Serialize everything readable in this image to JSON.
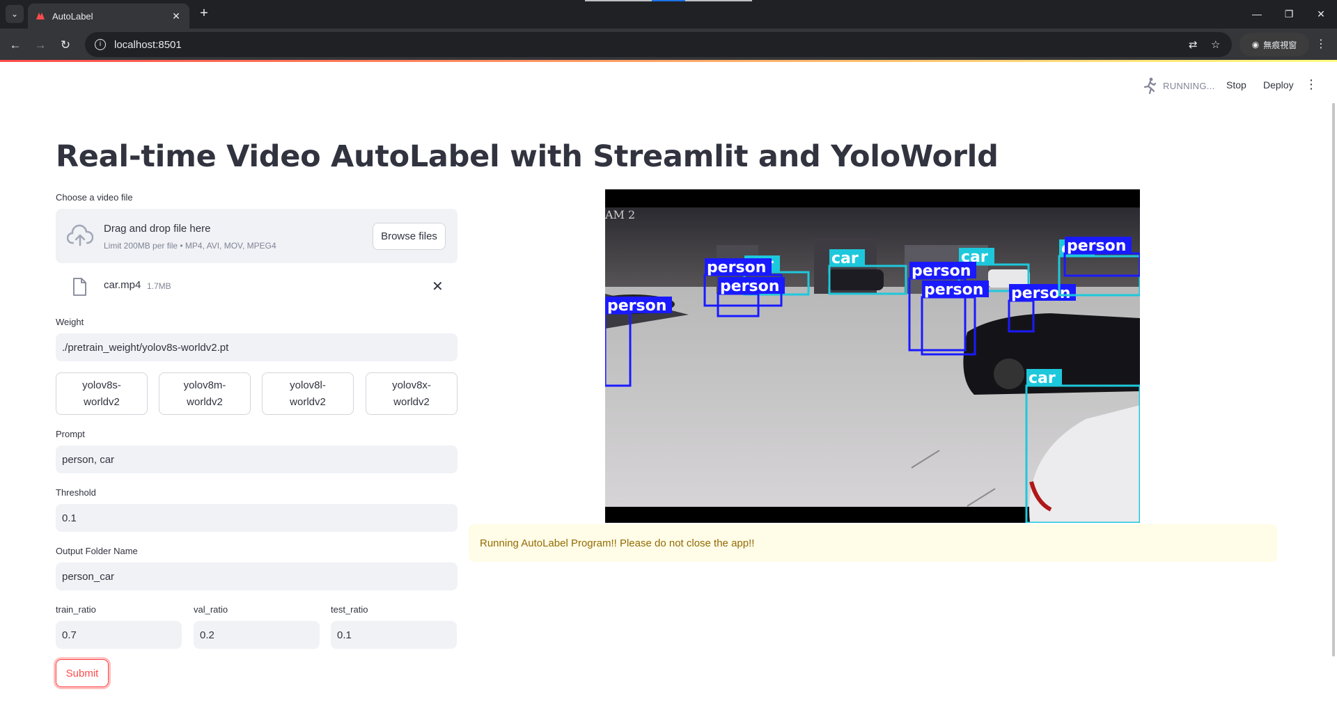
{
  "browser": {
    "tab_title": "AutoLabel",
    "url": "localhost:8501",
    "profile_label": "無痕視窗"
  },
  "header": {
    "status": "RUNNING...",
    "stop_label": "Stop",
    "deploy_label": "Deploy"
  },
  "page": {
    "title": "Real-time Video AutoLabel with Streamlit and YoloWorld"
  },
  "uploader": {
    "label": "Choose a video file",
    "drag_text": "Drag and drop file here",
    "limit_text": "Limit 200MB per file • MP4, AVI, MOV, MPEG4",
    "browse_label": "Browse files",
    "file_name": "car.mp4",
    "file_size": "1.7MB"
  },
  "weight": {
    "label": "Weight",
    "value": "./pretrain_weight/yolov8s-worldv2.pt",
    "models": [
      {
        "line1": "yolov8s-",
        "line2": "worldv2"
      },
      {
        "line1": "yolov8m-",
        "line2": "worldv2"
      },
      {
        "line1": "yolov8l-",
        "line2": "worldv2"
      },
      {
        "line1": "yolov8x-",
        "line2": "worldv2"
      }
    ]
  },
  "prompt": {
    "label": "Prompt",
    "value": "person, car"
  },
  "threshold": {
    "label": "Threshold",
    "value": "0.1"
  },
  "output": {
    "label": "Output Folder Name",
    "value": "person_car"
  },
  "ratios": {
    "train": {
      "label": "train_ratio",
      "value": "0.7"
    },
    "val": {
      "label": "val_ratio",
      "value": "0.2"
    },
    "test": {
      "label": "test_ratio",
      "value": "0.1"
    }
  },
  "submit_label": "Submit",
  "video": {
    "overlay_text": "AM 2",
    "detections": [
      "car",
      "car",
      "car",
      "person",
      "person",
      "person",
      "person",
      "person",
      "person",
      "car",
      "person",
      "car"
    ]
  },
  "alert": {
    "message": "Running AutoLabel Program!! Please do not close the app!!"
  },
  "colors": {
    "accent": "#ff4b4b",
    "person_box": "#1a1aff",
    "car_box": "#1ec8dc",
    "alert_bg": "#fffce7",
    "alert_text": "#926c05"
  }
}
